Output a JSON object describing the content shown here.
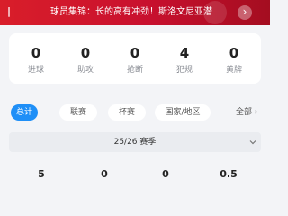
{
  "banner": {
    "mark": "|",
    "title": "球员集锦：长的高有冲劲！斯洛文尼亚潜",
    "arrow": "›"
  },
  "stats": [
    {
      "value": "0",
      "label": "进球"
    },
    {
      "value": "0",
      "label": "助攻"
    },
    {
      "value": "0",
      "label": "抢断"
    },
    {
      "value": "4",
      "label": "犯规"
    },
    {
      "value": "0",
      "label": "黄牌"
    }
  ],
  "filters": {
    "chips": [
      "总计",
      "联赛",
      "杯赛",
      "国家/地区"
    ],
    "active_index": 0,
    "all_label": "全部 ›"
  },
  "season": {
    "label": "25/26 赛季"
  },
  "summary_values": [
    "5",
    "0",
    "0",
    "0.5"
  ],
  "colors": {
    "banner_red": "#c8102e",
    "accent_blue": "#1f8ff7"
  }
}
